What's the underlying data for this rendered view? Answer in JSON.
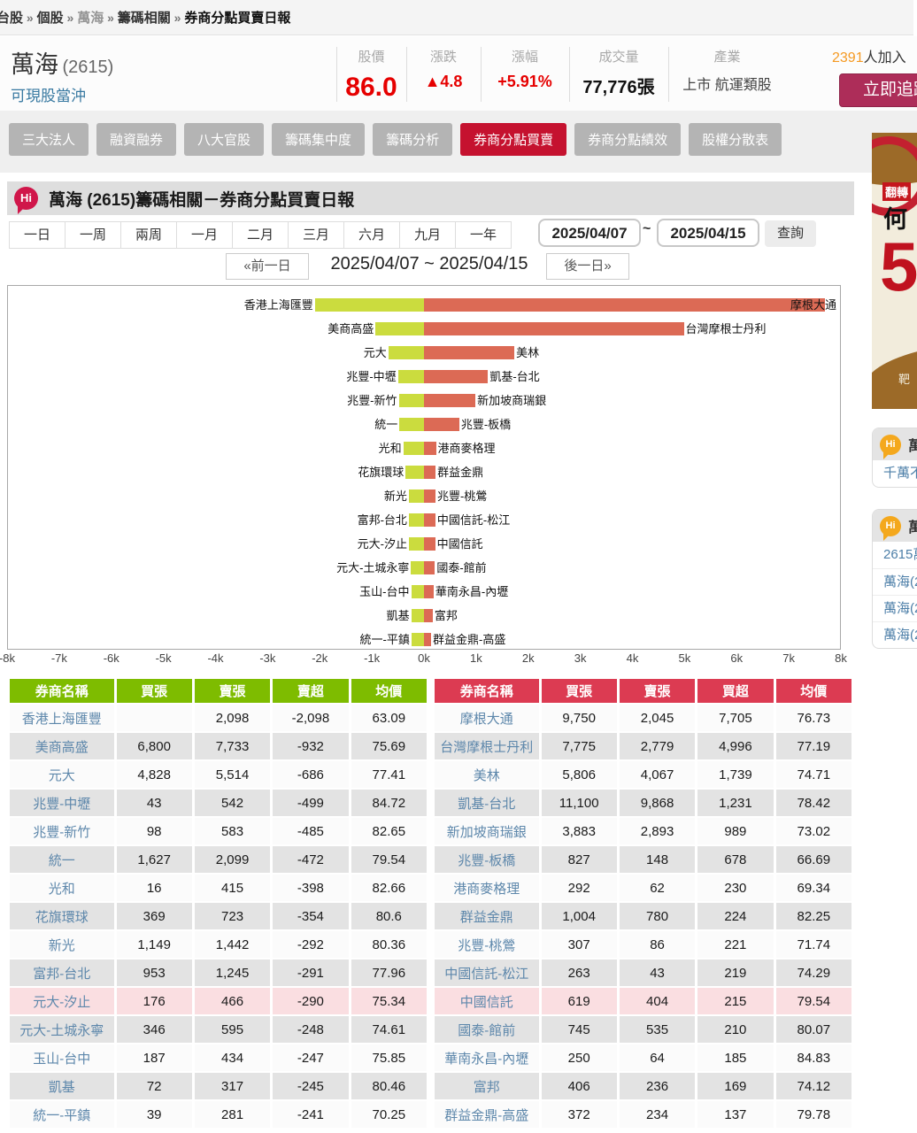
{
  "breadcrumb": {
    "separator": "»",
    "items": [
      "台股",
      "個股",
      "萬海",
      "籌碼相關",
      "券商分點買賣日報"
    ]
  },
  "header": {
    "stock_name": "萬海",
    "stock_code": "(2615)",
    "day_trade_label": "可現股當沖",
    "stats": [
      {
        "label": "股價",
        "value": "86.0",
        "style": "price"
      },
      {
        "label": "漲跌",
        "value": "▲4.8",
        "style": "red"
      },
      {
        "label": "漲幅",
        "value": "+5.91%",
        "style": "red"
      },
      {
        "label": "成交量",
        "value": "77,776張",
        "style": "volume"
      },
      {
        "label": "產業",
        "value": "上市 航運類股",
        "style": "plain"
      }
    ],
    "followers_count": "2391",
    "followers_suffix": "人加入",
    "follow_button": "立即追蹤"
  },
  "tabs": {
    "active_index": 5,
    "items": [
      "三大法人",
      "融資融券",
      "八大官股",
      "籌碼集中度",
      "籌碼分析",
      "券商分點買賣",
      "券商分點績效",
      "股權分散表"
    ]
  },
  "section": {
    "logo": "Hi",
    "title": "萬海 (2615)籌碼相關－券商分點買賣日報"
  },
  "period_tabs": [
    "一日",
    "一周",
    "兩周",
    "一月",
    "二月",
    "三月",
    "六月",
    "九月",
    "一年"
  ],
  "date_query": {
    "start": "2025/04/07",
    "tilde": "~",
    "end": "2025/04/15",
    "query_button": "查詢"
  },
  "day_nav": {
    "prev": "«前一日",
    "range": "2025/04/07 ~ 2025/04/15",
    "next": "後一日»"
  },
  "chart_data": {
    "type": "bar",
    "orientation": "horizontal-diverging",
    "xlim": [
      -8000,
      8000
    ],
    "axis_ticks": [
      "-8k",
      "-7k",
      "-6k",
      "-5k",
      "-4k",
      "-3k",
      "-2k",
      "-1k",
      "0k",
      "1k",
      "2k",
      "3k",
      "4k",
      "5k",
      "6k",
      "7k",
      "8k"
    ],
    "colors": {
      "sell_bar": "#cbdc3e",
      "buy_bar": "#dc6a55"
    },
    "pairs": [
      {
        "sell_name": "香港上海匯豐",
        "sell_value": 2098,
        "buy_name": "摩根大通",
        "buy_value": 7705,
        "buy_label_inside": true
      },
      {
        "sell_name": "美商高盛",
        "sell_value": 932,
        "buy_name": "台灣摩根士丹利",
        "buy_value": 4996
      },
      {
        "sell_name": "元大",
        "sell_value": 686,
        "buy_name": "美林",
        "buy_value": 1739
      },
      {
        "sell_name": "兆豐-中壢",
        "sell_value": 499,
        "buy_name": "凱基-台北",
        "buy_value": 1231
      },
      {
        "sell_name": "兆豐-新竹",
        "sell_value": 485,
        "buy_name": "新加坡商瑞銀",
        "buy_value": 989
      },
      {
        "sell_name": "統一",
        "sell_value": 472,
        "buy_name": "兆豐-板橋",
        "buy_value": 678
      },
      {
        "sell_name": "光和",
        "sell_value": 398,
        "buy_name": "港商麥格理",
        "buy_value": 230
      },
      {
        "sell_name": "花旗環球",
        "sell_value": 354,
        "buy_name": "群益金鼎",
        "buy_value": 224
      },
      {
        "sell_name": "新光",
        "sell_value": 292,
        "buy_name": "兆豐-桃鶯",
        "buy_value": 221
      },
      {
        "sell_name": "富邦-台北",
        "sell_value": 291,
        "buy_name": "中國信託-松江",
        "buy_value": 219
      },
      {
        "sell_name": "元大-汐止",
        "sell_value": 290,
        "buy_name": "中國信託",
        "buy_value": 215
      },
      {
        "sell_name": "元大-土城永寧",
        "sell_value": 248,
        "buy_name": "國泰-館前",
        "buy_value": 210
      },
      {
        "sell_name": "玉山-台中",
        "sell_value": 247,
        "buy_name": "華南永昌-內壢",
        "buy_value": 185
      },
      {
        "sell_name": "凱基",
        "sell_value": 245,
        "buy_name": "富邦",
        "buy_value": 169
      },
      {
        "sell_name": "統一-平鎮",
        "sell_value": 241,
        "buy_name": "群益金鼎-高盛",
        "buy_value": 137
      }
    ]
  },
  "tables": {
    "sell": {
      "header_color": "#7ebc00",
      "headers": [
        "券商名稱",
        "買張",
        "賣張",
        "賣超",
        "均價"
      ],
      "highlight_row": 10,
      "rows": [
        [
          "香港上海匯豐",
          "",
          "2,098",
          "-2,098",
          "63.09"
        ],
        [
          "美商高盛",
          "6,800",
          "7,733",
          "-932",
          "75.69"
        ],
        [
          "元大",
          "4,828",
          "5,514",
          "-686",
          "77.41"
        ],
        [
          "兆豐-中壢",
          "43",
          "542",
          "-499",
          "84.72"
        ],
        [
          "兆豐-新竹",
          "98",
          "583",
          "-485",
          "82.65"
        ],
        [
          "統一",
          "1,627",
          "2,099",
          "-472",
          "79.54"
        ],
        [
          "光和",
          "16",
          "415",
          "-398",
          "82.66"
        ],
        [
          "花旗環球",
          "369",
          "723",
          "-354",
          "80.6"
        ],
        [
          "新光",
          "1,149",
          "1,442",
          "-292",
          "80.36"
        ],
        [
          "富邦-台北",
          "953",
          "1,245",
          "-291",
          "77.96"
        ],
        [
          "元大-汐止",
          "176",
          "466",
          "-290",
          "75.34"
        ],
        [
          "元大-土城永寧",
          "346",
          "595",
          "-248",
          "74.61"
        ],
        [
          "玉山-台中",
          "187",
          "434",
          "-247",
          "75.85"
        ],
        [
          "凱基",
          "72",
          "317",
          "-245",
          "80.46"
        ],
        [
          "統一-平鎮",
          "39",
          "281",
          "-241",
          "70.25"
        ]
      ]
    },
    "buy": {
      "header_color": "#dc3b52",
      "headers": [
        "券商名稱",
        "買張",
        "賣張",
        "買超",
        "均價"
      ],
      "highlight_row": 10,
      "rows": [
        [
          "摩根大通",
          "9,750",
          "2,045",
          "7,705",
          "76.73"
        ],
        [
          "台灣摩根士丹利",
          "7,775",
          "2,779",
          "4,996",
          "77.19"
        ],
        [
          "美林",
          "5,806",
          "4,067",
          "1,739",
          "74.71"
        ],
        [
          "凱基-台北",
          "11,100",
          "9,868",
          "1,231",
          "78.42"
        ],
        [
          "新加坡商瑞銀",
          "3,883",
          "2,893",
          "989",
          "73.02"
        ],
        [
          "兆豐-板橋",
          "827",
          "148",
          "678",
          "66.69"
        ],
        [
          "港商麥格理",
          "292",
          "62",
          "230",
          "69.34"
        ],
        [
          "群益金鼎",
          "1,004",
          "780",
          "224",
          "82.25"
        ],
        [
          "兆豐-桃鶯",
          "307",
          "86",
          "221",
          "71.74"
        ],
        [
          "中國信託-松江",
          "263",
          "43",
          "219",
          "74.29"
        ],
        [
          "中國信託",
          "619",
          "404",
          "215",
          "79.54"
        ],
        [
          "國泰-館前",
          "745",
          "535",
          "210",
          "80.07"
        ],
        [
          "華南永昌-內壢",
          "250",
          "64",
          "185",
          "84.83"
        ],
        [
          "富邦",
          "406",
          "236",
          "169",
          "74.12"
        ],
        [
          "群益金鼎-高盛",
          "372",
          "234",
          "137",
          "79.78"
        ]
      ]
    }
  },
  "sidebar": {
    "ad": {
      "badge": "翻轉",
      "text1": "何",
      "text2": "5",
      "text3": "靶"
    },
    "cards": [
      {
        "logo": "Hi",
        "header": "萬",
        "links": [
          "千萬不"
        ]
      },
      {
        "logo": "Hi",
        "header": "萬",
        "links": [
          "2615萬",
          "萬海(2",
          "萬海(2",
          "萬海(2"
        ]
      }
    ]
  }
}
